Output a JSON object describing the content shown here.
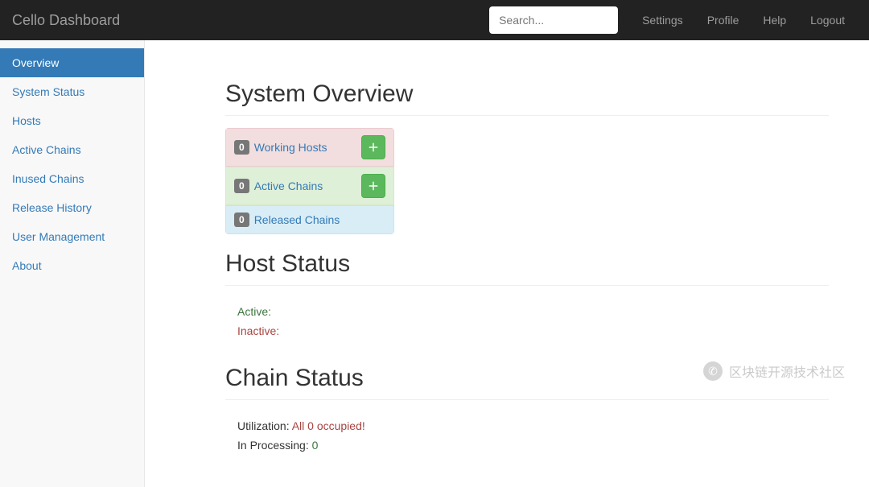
{
  "navbar": {
    "brand": "Cello Dashboard",
    "search_placeholder": "Search...",
    "links": [
      "Settings",
      "Profile",
      "Help",
      "Logout"
    ]
  },
  "sidebar": {
    "items": [
      {
        "label": "Overview",
        "active": true
      },
      {
        "label": "System Status",
        "active": false
      },
      {
        "label": "Hosts",
        "active": false
      },
      {
        "label": "Active Chains",
        "active": false
      },
      {
        "label": "Inused Chains",
        "active": false
      },
      {
        "label": "Release History",
        "active": false
      },
      {
        "label": "User Management",
        "active": false
      },
      {
        "label": "About",
        "active": false
      }
    ]
  },
  "sections": {
    "system_overview": "System Overview",
    "host_status": "Host Status",
    "chain_status": "Chain Status"
  },
  "overview_cards": [
    {
      "count": "0",
      "label": "Working Hosts",
      "color": "red",
      "has_add": true
    },
    {
      "count": "0",
      "label": "Active Chains",
      "color": "green",
      "has_add": true
    },
    {
      "count": "0",
      "label": "Released Chains",
      "color": "blue",
      "has_add": false
    }
  ],
  "host_status": {
    "active_label": "Active:",
    "inactive_label": "Inactive:"
  },
  "chain_status": {
    "utilization_label": "Utilization: ",
    "utilization_value": "All 0 occupied!",
    "processing_label": "In Processing: ",
    "processing_value": "0"
  },
  "watermark": "区块链开源技术社区"
}
